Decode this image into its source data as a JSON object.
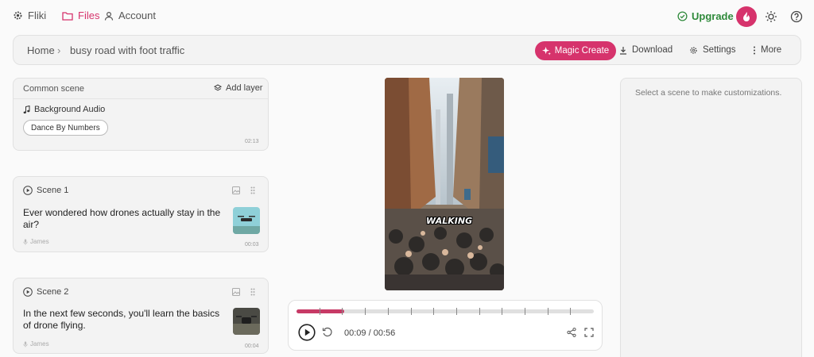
{
  "nav": {
    "brand": "Fliki",
    "files": "Files",
    "account": "Account",
    "upgrade": "Upgrade"
  },
  "breadcrumb": {
    "home": "Home",
    "separator": "›",
    "current": "busy road with foot traffic"
  },
  "toolbar": {
    "magic_create": "Magic Create",
    "download": "Download",
    "settings": "Settings",
    "more": "More"
  },
  "common_scene": {
    "title": "Common scene",
    "add_layer": "Add layer",
    "audio_label": "Background Audio",
    "audio_track": "Dance By Numbers",
    "duration": "02:13"
  },
  "scenes": [
    {
      "title": "Scene 1",
      "text": "Ever wondered how drones actually stay in the air?",
      "voice": "James",
      "duration": "00:03"
    },
    {
      "title": "Scene 2",
      "text": "In the next few seconds, you'll learn the basics of drone flying.",
      "voice": "James",
      "duration": "00:04"
    }
  ],
  "video": {
    "overlay_text": "WALKING"
  },
  "player": {
    "time": "00:09 / 00:56",
    "progress": 0.16
  },
  "right_panel": {
    "hint": "Select a scene to make customizations."
  },
  "colors": {
    "accent": "#d6336c",
    "upgrade": "#2f8a3b",
    "progress": "#c73a66"
  }
}
